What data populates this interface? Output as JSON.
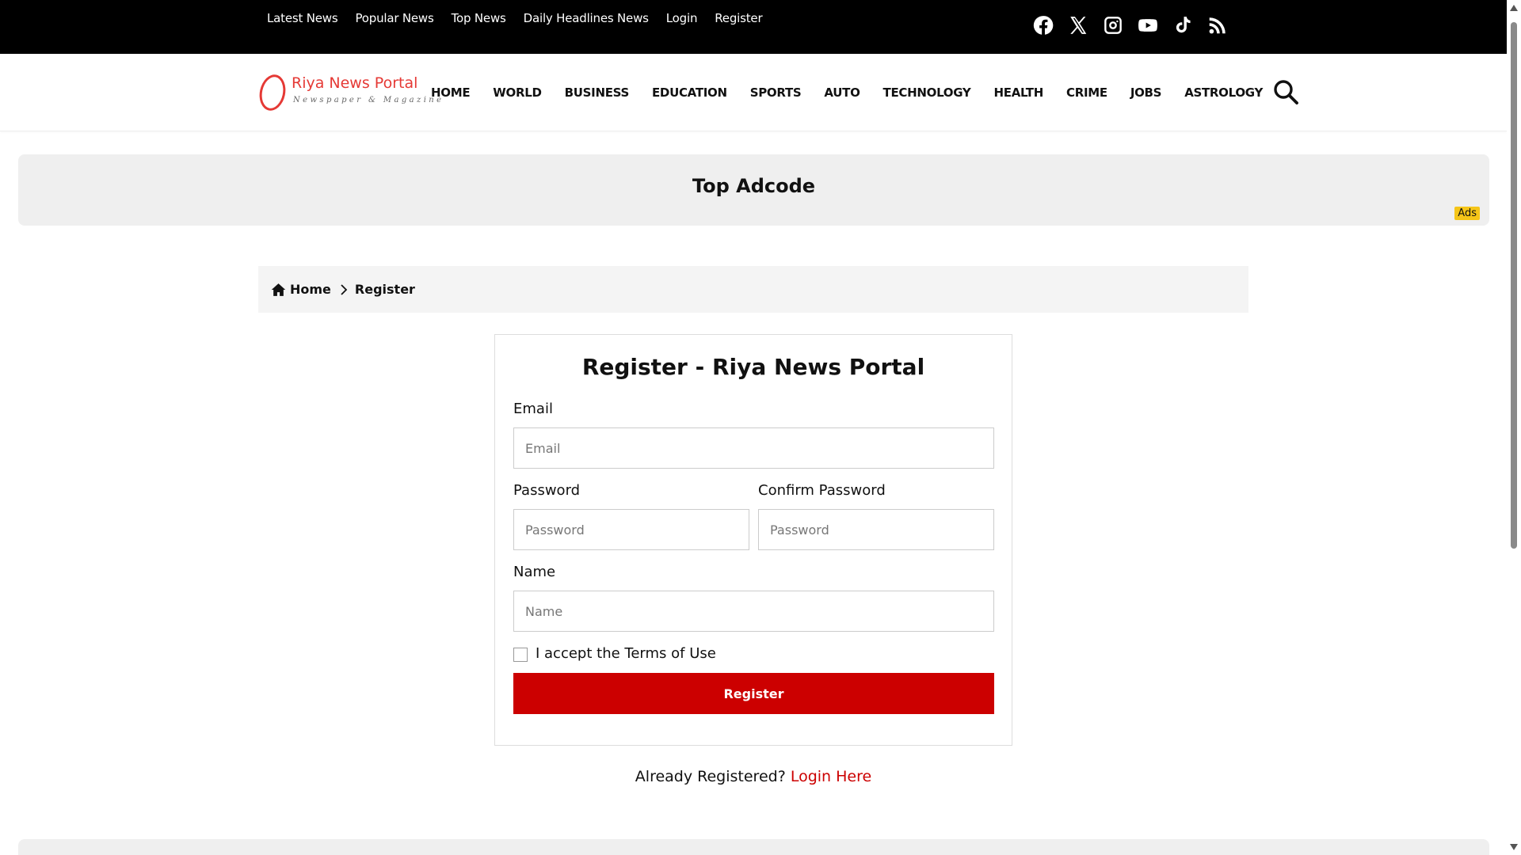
{
  "topbar": {
    "links": [
      "Latest News",
      "Popular News",
      "Top News",
      "Daily Headlines News",
      "Login",
      "Register"
    ],
    "social_icons": [
      "facebook-icon",
      "x-icon",
      "instagram-icon",
      "youtube-icon",
      "tiktok-icon",
      "rss-icon"
    ]
  },
  "header": {
    "logo_title": "Riya News Portal",
    "logo_subtitle": "Newspaper & Magazine",
    "nav": [
      "HOME",
      "WORLD",
      "BUSINESS",
      "EDUCATION",
      "SPORTS",
      "AUTO",
      "TECHNOLOGY",
      "HEALTH",
      "CRIME",
      "JOBS",
      "ASTROLOGY"
    ],
    "search_icon": "search-icon"
  },
  "ad": {
    "title": "Top Adcode",
    "badge": "Ads"
  },
  "breadcrumb": {
    "home": "Home",
    "current": "Register"
  },
  "form": {
    "title": "Register - Riya News Portal",
    "email_label": "Email",
    "email_placeholder": "Email",
    "password_label": "Password",
    "password_placeholder": "Password",
    "confirm_label": "Confirm Password",
    "confirm_placeholder": "Password",
    "name_label": "Name",
    "name_placeholder": "Name",
    "terms_label": "I accept the Terms of Use",
    "submit_label": "Register"
  },
  "footer_note": {
    "text": "Already Registered?",
    "link": "Login Here"
  },
  "colors": {
    "accent": "#cc0000",
    "logo": "#e53935",
    "topbar": "#000000",
    "ad_badge": "#f5c518"
  }
}
